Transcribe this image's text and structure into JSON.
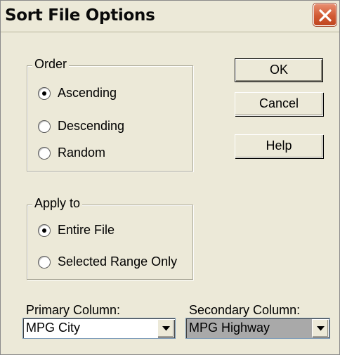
{
  "window": {
    "title": "Sort File Options"
  },
  "order": {
    "legend": "Order",
    "options": [
      {
        "label": "Ascending",
        "checked": true
      },
      {
        "label": "Descending",
        "checked": false
      },
      {
        "label": "Random",
        "checked": false
      }
    ]
  },
  "apply_to": {
    "legend": "Apply to",
    "options": [
      {
        "label": "Entire File",
        "checked": true
      },
      {
        "label": "Selected Range Only",
        "checked": false
      }
    ]
  },
  "buttons": {
    "ok": "OK",
    "cancel": "Cancel",
    "help": "Help"
  },
  "primary_column": {
    "label": "Primary Column:",
    "value": "MPG City"
  },
  "secondary_column": {
    "label": "Secondary Column:",
    "value": "MPG Highway"
  },
  "colors": {
    "dialog_bg": "#ece9d8",
    "close_button": "#d25a33",
    "secondary_select_bg": "#a9a9a9"
  },
  "icons": {
    "close": "close-icon",
    "dropdown": "chevron-down-icon"
  }
}
